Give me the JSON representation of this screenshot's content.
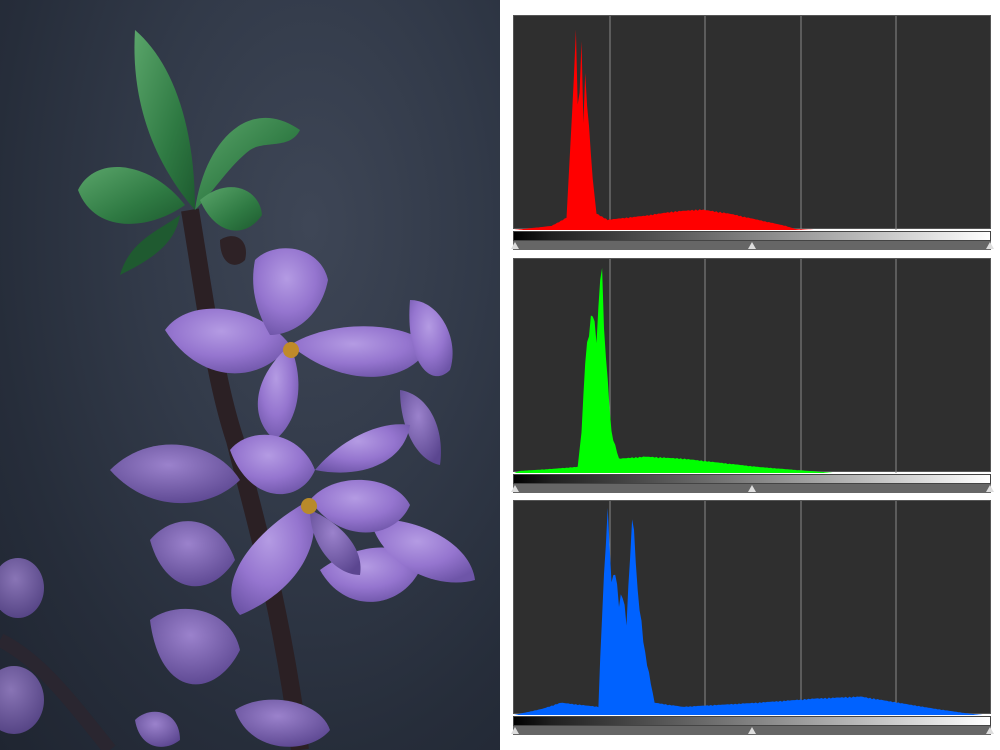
{
  "photo": {
    "subject": "flower-photo"
  },
  "histograms": [
    {
      "channel": "red",
      "color": "#ff0000"
    },
    {
      "channel": "green",
      "color": "#00ff00"
    },
    {
      "channel": "blue",
      "color": "#0062ff"
    }
  ],
  "colors": {
    "plot_background": "#2f2f2f",
    "grid": "#8a8a8a",
    "slider": "#666666"
  }
}
